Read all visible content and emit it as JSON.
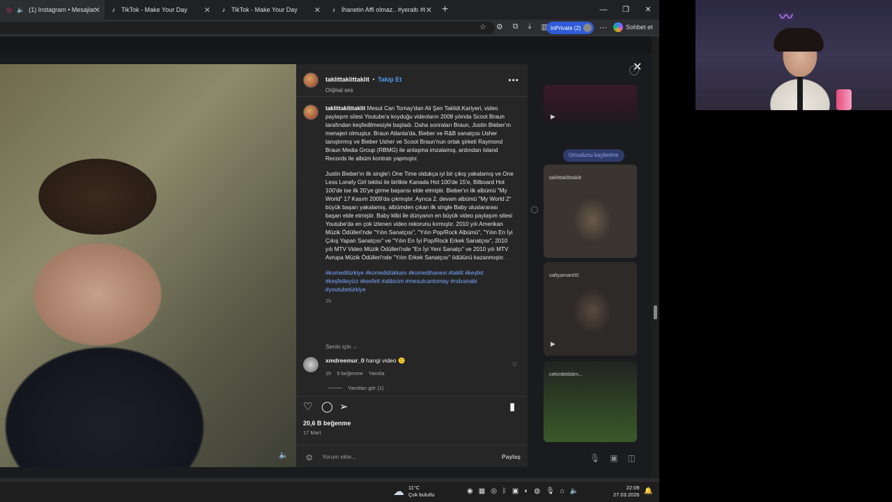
{
  "browser": {
    "tabs": [
      {
        "label": "(1) Instagram • Mesajlar"
      },
      {
        "label": "TikTok - Make Your Day"
      },
      {
        "label": "TikTok - Make Your Day"
      },
      {
        "label": "İhanetin Affi olmaz.. #yeraltı #boz"
      }
    ],
    "inprivate_label": "InPrivate (2)",
    "chat_label": "Sohbet et"
  },
  "post": {
    "username": "taklittaklittaklit",
    "separator": "•",
    "follow_label": "Takip Et",
    "audio": "Orijinal ses",
    "more_label": "•••",
    "caption_user": "taklittaklittaklit",
    "caption_p1": "Mesut Can Tomay'dan Ali Şen Taklidi.Kariyeri, video paylaşım sitesi Youtube'a koyduğu videoların 2008 yılında Scoot Braun tarafından keşfedilmesiyle başladı. Daha sonraları Braun, Justin Bieber'ın menajeri olmuştur. Braun Atlanta'da, Bieber ve R&B sanatçısı Usher tanıştırmış ve Bieber Usher ve Scoot Braun'nun ortak şirketi Raymond Braun Media Group (RBMG) ile anlaşma imzalamış, ardından Island Records ile albüm kontratı yapmıştır.",
    "caption_p2": "Justin Bieber'ın ilk single'ı One Time oldukça iyi bir çıkış yakalamış ve One Less Lonely Girl teklisi ile birlikte Kanada Hot 100'de 15'e, Bilboard Hot 100'de ise ilk 20'ye girme başarısı elde etmiştir. Bieber'ın ilk albümü \"My World\" 17 Kasım 2009'da çıkmıştır. Ayrıca 2. devam albümü \"My World 2\" büyük başarı yakalamış, albümden çıkan ilk single Baby uluslararası başarı elde etmiştir. Baby klibi ile dünyanın en büyük video paylaşım sitesi Youtube'da en çok izlenen video rekorunu kırmıştır. 2010 yılı Amerikan Müzik Ödülleri'nde \"Yılın Sanatçısı\", \"Yılın Pop/Rock Albümü\", \"Yılın En İyi Çıkış Yapan Sanatçısı\" ve \"Yılın En İyi Pop/Rock Erkek Sanatçısı\", 2010 yılı MTV Video Müzik Ödülleri'nde \"En İyi Yeni Sanatçı\" ve 2010 yılı MTV Avrupa Müzik Ödülleri'nde \"Yılın Erkek Sanatçısı\" ödülünü kazanmıştır.",
    "hashtags": "#komeditürkiye #komedidükkanı #komedihanesi #taklit #keşfet #keşfetteyizz #kesfett #alibicim #mesutcantomay #rıdvanabi #youtubetürkiye",
    "caption_time": "1h",
    "for_you": "Senin için ⌵",
    "comment": {
      "user": "xmdreemur_0",
      "text": "hangi video 😕",
      "time": "1h",
      "likes": "9 beğenme",
      "reply": "Yanıtla"
    },
    "see_replies": "Yanıtları gör (1)",
    "likes_count": "20,6 B beğenme",
    "date": "17 Mart",
    "comment_placeholder": "Yorum ekle...",
    "share_label": "Paylaş"
  },
  "right_panel": {
    "bubble": "Umudunu kaybetme",
    "card1_name": "taklittaklittaklit",
    "card2_name": "saltyaman00",
    "card3_name": "cekirdekbitm..."
  },
  "taskbar": {
    "temp": "11°C",
    "weather": "Çok bulutlu",
    "time": "22:09",
    "date": "27.03.2026"
  },
  "colors": {
    "accent_blue": "#4f9cf5",
    "hashtag_blue": "#7aa7ff",
    "inprivate_blue": "#2f5bd6"
  }
}
